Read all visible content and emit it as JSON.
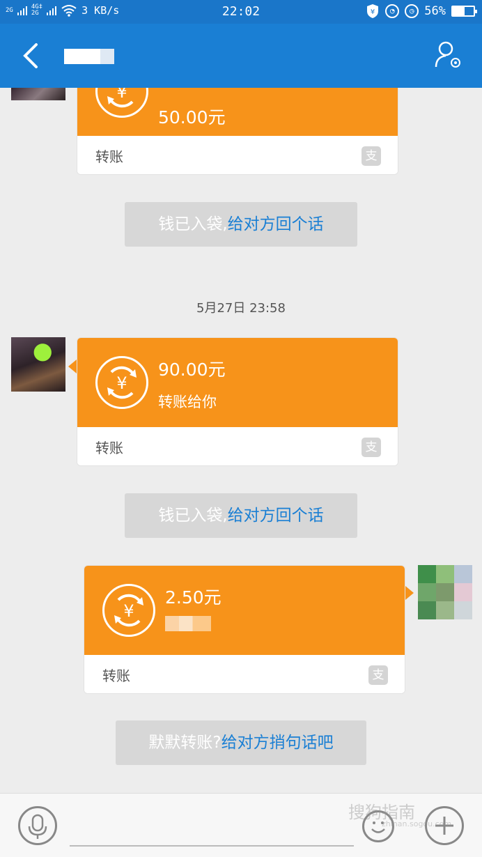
{
  "status_bar": {
    "net1": "2G",
    "net2": "4G‡",
    "net3": "2G",
    "speed": "3 KB/s",
    "time": "22:02",
    "battery": "56%",
    "battery_level": 0.56
  },
  "header": {
    "contact_name": ""
  },
  "messages": [
    {
      "amount": "50.00元",
      "label": "转账",
      "alipay": "支"
    },
    {
      "notice_grey": "钱已入袋,",
      "notice_link": "给对方回个话"
    },
    {
      "timestamp": "5月27日 23:58"
    },
    {
      "amount": "90.00元",
      "memo": "转账给你",
      "label": "转账",
      "alipay": "支"
    },
    {
      "notice_grey": "钱已入袋,",
      "notice_link": "给对方回个话"
    },
    {
      "amount": "2.50元",
      "label": "转账",
      "alipay": "支"
    },
    {
      "notice_grey": "默默转账?",
      "notice_link": "给对方捎句话吧"
    }
  ],
  "watermark": {
    "text": "搜狗指南",
    "sub": "zhinan.sogou.com"
  },
  "colors": {
    "header": "#1a7fd4",
    "card_orange": "#f7931a",
    "link": "#1a7fd4"
  },
  "icons": [
    "back-icon",
    "profile-settings-icon",
    "transfer-coin-icon",
    "alipay-icon",
    "microphone-icon",
    "emoji-icon",
    "plus-icon"
  ]
}
